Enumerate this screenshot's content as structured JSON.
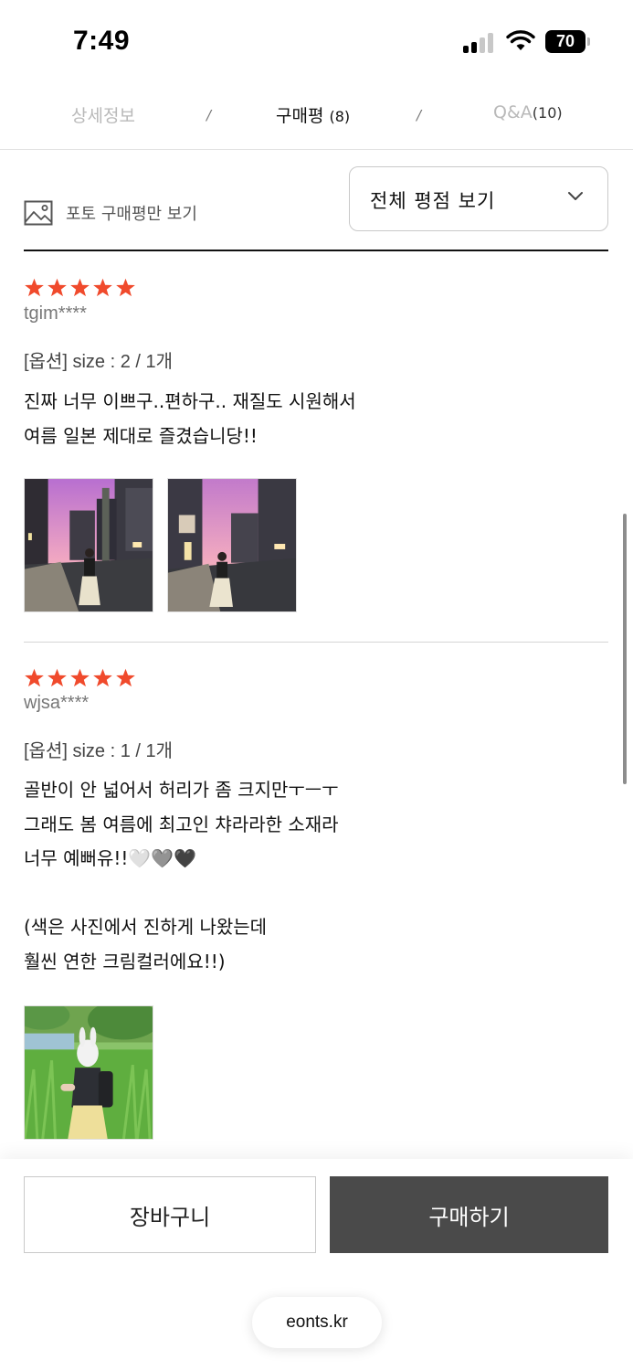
{
  "status_bar": {
    "time": "7:49",
    "battery": "70"
  },
  "tabs": {
    "detail": "상세정보",
    "review": "구매평",
    "review_count": "(8)",
    "qa": "Q&A",
    "qa_count": "(10)",
    "separator": "/"
  },
  "filter": {
    "photo_only_label": "포토 구매평만 보기",
    "rating_select_value": "전체 평점 보기"
  },
  "reviews": [
    {
      "rating": 5,
      "user": "tgim****",
      "option": "[옵션] size : 2 / 1개",
      "text": "진짜 너무 이쁘구..편하구.. 재질도 시원해서\n여름 일본 제대로 즐겼습니당!!"
    },
    {
      "rating": 5,
      "user": "wjsa****",
      "option": "[옵션] size : 1 / 1개",
      "text": "골반이 안 넓어서 허리가 좀 크지만ㅜㅡㅜ\n그래도 봄 여름에 최고인 챠라라한 소재라\n너무 예뻐유!!🤍🩶🖤\n\n(색은 사진에서 진하게 나왔는데\n훨씬 연한 크림컬러에요!!)"
    }
  ],
  "bottom_bar": {
    "cart_label": "장바구니",
    "buy_label": "구매하기",
    "url": "eonts.kr"
  },
  "colors": {
    "star": "#f04a2c",
    "buy_button": "#4a4a4a",
    "tab_inactive": "#b9b9b9"
  }
}
